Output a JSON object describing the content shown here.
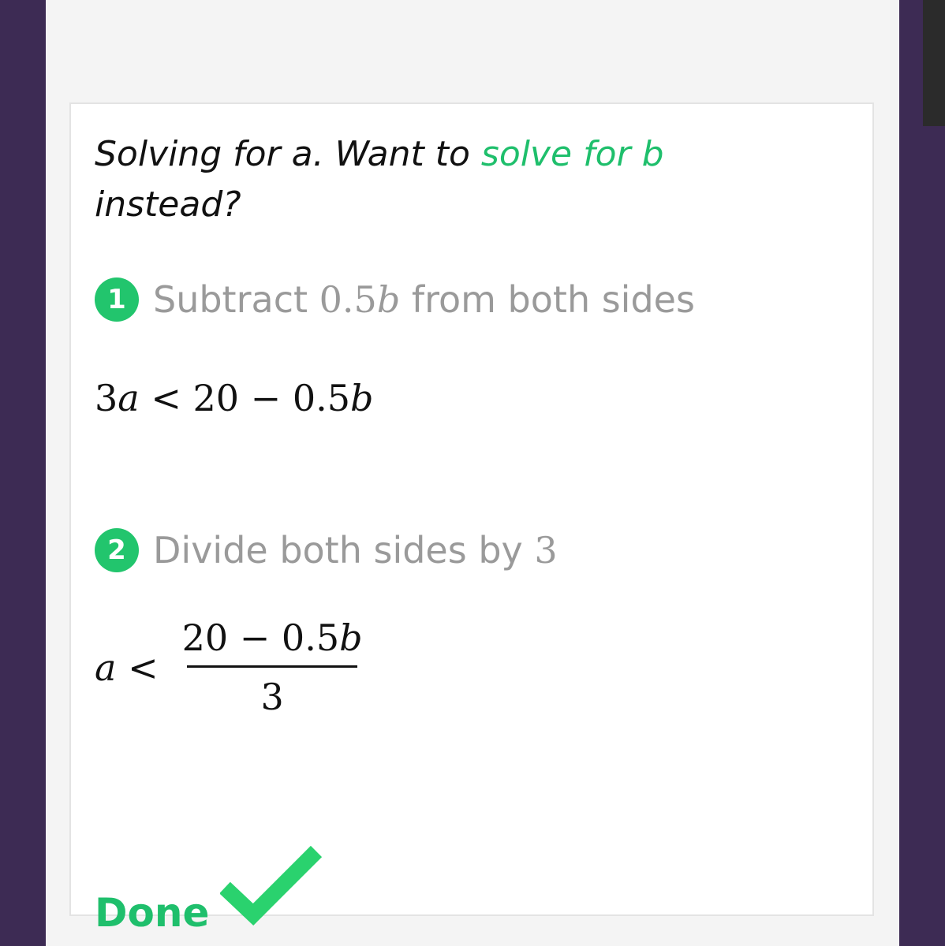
{
  "intro": {
    "prefix": "Solving for a. Want to",
    "link": "solve for b",
    "suffix": "instead?"
  },
  "steps": [
    {
      "number": "1",
      "text_before": "Subtract",
      "math_num": "0.5",
      "math_var": "b",
      "text_after": "from both sides",
      "result": {
        "coef": "3",
        "var": "a",
        "rel": "<",
        "rhs_num": "20 − 0.5",
        "rhs_var": "b"
      }
    },
    {
      "number": "2",
      "text_before": "Divide both sides by",
      "math_num": "3",
      "result": {
        "var": "a",
        "rel": "<",
        "numerator_num": "20 − 0.5",
        "numerator_var": "b",
        "denominator": "3"
      }
    }
  ],
  "done_label": "Done",
  "colors": {
    "accent": "#1fbf6c",
    "badge": "#22c56d",
    "muted": "#9a9a9a",
    "side_bg": "#3d2b54"
  },
  "icons": {
    "done": "checkmark-icon"
  }
}
